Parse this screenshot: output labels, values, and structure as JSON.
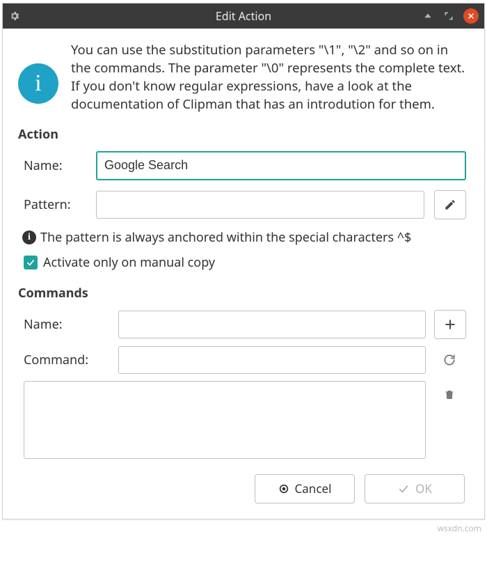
{
  "window": {
    "title": "Edit Action"
  },
  "intro": {
    "icon_glyph": "i",
    "text": "You can use the substitution parameters \"\\1\", \"\\2\" and so on in the commands. The parameter \"\\0\" represents the complete text. If you don't know regular expressions, have a look at the documentation of Clipman that has an introdution for them."
  },
  "action": {
    "header": "Action",
    "name_label": "Name:",
    "name_value": "Google Search",
    "pattern_label": "Pattern:",
    "pattern_value": "",
    "hint": "The pattern is always anchored within the special characters ^$",
    "activate_label": "Activate only on manual copy",
    "activate_checked": true
  },
  "commands": {
    "header": "Commands",
    "name_label": "Name:",
    "name_value": "",
    "command_label": "Command:",
    "command_value": ""
  },
  "footer": {
    "cancel": "Cancel",
    "ok": "OK"
  },
  "watermark": "wsxdn.com"
}
